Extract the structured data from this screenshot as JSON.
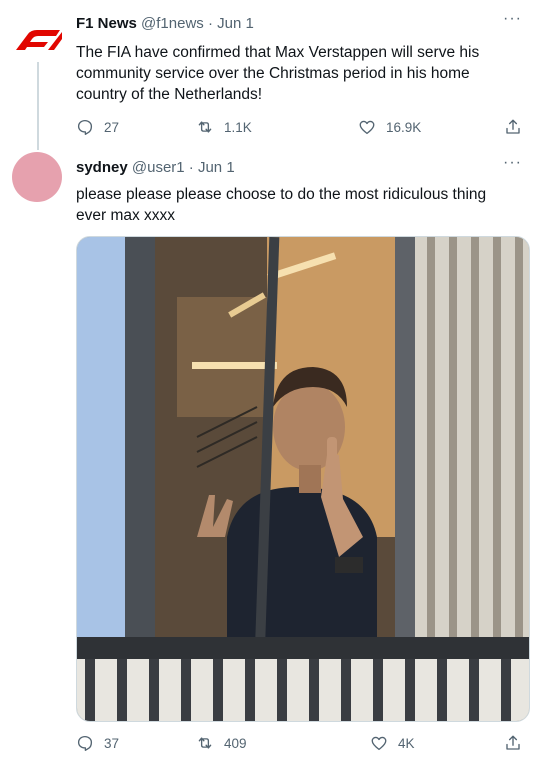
{
  "tweet1": {
    "display_name": "F1 News",
    "handle": "@f1news",
    "sep": " · ",
    "date": "Jun 1",
    "text": "The FIA have confirmed that Max Verstappen will serve his community service over the Christmas period in his home country of the Netherlands!",
    "replies": "27",
    "retweets": "1.1K",
    "likes": "16.9K",
    "more": "···"
  },
  "tweet2": {
    "display_name": "sydney",
    "handle": "@user1",
    "sep": " · ",
    "date": "Jun 1",
    "text": "please please please choose to do the most ridiculous thing ever max xxxx",
    "replies": "37",
    "retweets": "409",
    "likes": "4K",
    "more": "···"
  },
  "colors": {
    "f1_red": "#e10600",
    "avatar_pink": "#e6a1ae",
    "meta_gray": "#536471"
  },
  "icons": [
    "reply-icon",
    "retweet-icon",
    "like-icon",
    "share-icon",
    "more-icon"
  ]
}
